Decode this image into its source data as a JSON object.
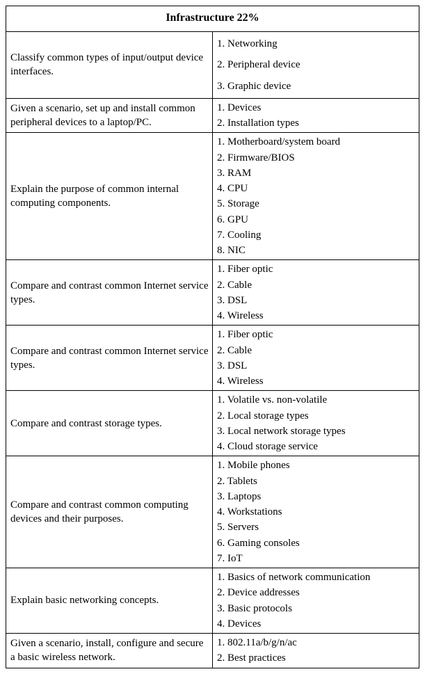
{
  "header": "Infrastructure 22%",
  "rows": [
    {
      "objective": "Classify common types of input/output device interfaces.",
      "items": [
        "1. Networking",
        "2. Peripheral device",
        "3. Graphic device"
      ],
      "spaced": true
    },
    {
      "objective": "Given a scenario, set up and install common peripheral devices to a laptop/PC.",
      "items": [
        "1. Devices",
        "2. Installation types"
      ],
      "spaced": false
    },
    {
      "objective": "Explain the purpose of common internal computing components.",
      "items": [
        "1. Motherboard/system board",
        "2. Firmware/BIOS",
        "3. RAM",
        "4. CPU",
        "5. Storage",
        "6. GPU",
        "7. Cooling",
        "8. NIC"
      ],
      "spaced": false
    },
    {
      "objective": "Compare and contrast common Internet service types.",
      "items": [
        "1. Fiber optic",
        "2. Cable",
        "3. DSL",
        "4. Wireless"
      ],
      "spaced": false
    },
    {
      "objective": "Compare and contrast common Internet service types.",
      "items": [
        "1. Fiber optic",
        "2. Cable",
        "3. DSL",
        "4. Wireless"
      ],
      "spaced": false
    },
    {
      "objective": "Compare and contrast storage types.",
      "items": [
        "1. Volatile vs. non-volatile",
        "2. Local storage types",
        "3. Local network storage types",
        "4. Cloud storage service"
      ],
      "spaced": false
    },
    {
      "objective": "Compare and contrast common computing devices and their purposes.",
      "items": [
        "1. Mobile phones",
        "2. Tablets",
        "3. Laptops",
        "4. Workstations",
        "5. Servers",
        "6. Gaming consoles",
        "7. IoT"
      ],
      "spaced": false
    },
    {
      "objective": "Explain basic networking concepts.",
      "items": [
        "1. Basics of network communication",
        "2. Device addresses",
        "3. Basic protocols",
        "4. Devices"
      ],
      "spaced": false
    },
    {
      "objective": "Given a scenario, install, configure and secure a basic wireless network.",
      "items": [
        "1. 802.11a/b/g/n/ac",
        "2. Best practices"
      ],
      "spaced": false
    }
  ]
}
